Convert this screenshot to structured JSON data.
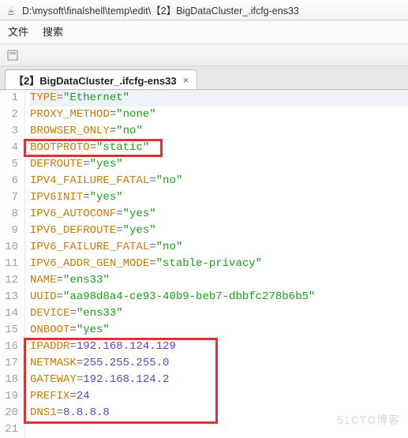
{
  "titlebar": {
    "path": "D:\\mysoft\\finalshell\\temp\\edit\\【2】BigDataCluster_.ifcfg-ens33"
  },
  "menubar": {
    "file": "文件",
    "search": "搜索"
  },
  "tab": {
    "label": "【2】BigDataCluster_.ifcfg-ens33",
    "close": "×"
  },
  "lines": [
    {
      "n": "1",
      "key": "TYPE",
      "eq": "=",
      "val": "\"Ethernet\"",
      "cls": "str"
    },
    {
      "n": "2",
      "key": "PROXY_METHOD",
      "eq": "=",
      "val": "\"none\"",
      "cls": "str"
    },
    {
      "n": "3",
      "key": "BROWSER_ONLY",
      "eq": "=",
      "val": "\"no\"",
      "cls": "str"
    },
    {
      "n": "4",
      "key": "BOOTPROTO",
      "eq": "=",
      "val": "\"static\"",
      "cls": "str"
    },
    {
      "n": "5",
      "key": "DEFROUTE",
      "eq": "=",
      "val": "\"yes\"",
      "cls": "str"
    },
    {
      "n": "6",
      "key": "IPV4_FAILURE_FATAL",
      "eq": "=",
      "val": "\"no\"",
      "cls": "str"
    },
    {
      "n": "7",
      "key": "IPV6INIT",
      "eq": "=",
      "val": "\"yes\"",
      "cls": "str"
    },
    {
      "n": "8",
      "key": "IPV6_AUTOCONF",
      "eq": "=",
      "val": "\"yes\"",
      "cls": "str"
    },
    {
      "n": "9",
      "key": "IPV6_DEFROUTE",
      "eq": "=",
      "val": "\"yes\"",
      "cls": "str"
    },
    {
      "n": "10",
      "key": "IPV6_FAILURE_FATAL",
      "eq": "=",
      "val": "\"no\"",
      "cls": "str"
    },
    {
      "n": "11",
      "key": "IPV6_ADDR_GEN_MODE",
      "eq": "=",
      "val": "\"stable-privacy\"",
      "cls": "str"
    },
    {
      "n": "12",
      "key": "NAME",
      "eq": "=",
      "val": "\"ens33\"",
      "cls": "str"
    },
    {
      "n": "13",
      "key": "UUID",
      "eq": "=",
      "val": "\"aa98d8a4-ce93-40b9-beb7-dbbfc278b6b5\"",
      "cls": "str"
    },
    {
      "n": "14",
      "key": "DEVICE",
      "eq": "=",
      "val": "\"ens33\"",
      "cls": "str"
    },
    {
      "n": "15",
      "key": "ONBOOT",
      "eq": "=",
      "val": "\"yes\"",
      "cls": "str"
    },
    {
      "n": "16",
      "key": "IPADDR",
      "eq": "=",
      "val": "192.168.124.129",
      "cls": "plain"
    },
    {
      "n": "17",
      "key": "NETMASK",
      "eq": "=",
      "val": "255.255.255.0",
      "cls": "plain"
    },
    {
      "n": "18",
      "key": "GATEWAY",
      "eq": "=",
      "val": "192.168.124.2",
      "cls": "plain"
    },
    {
      "n": "19",
      "key": "PREFIX",
      "eq": "=",
      "val": "24",
      "cls": "plain"
    },
    {
      "n": "20",
      "key": "DNS1",
      "eq": "=",
      "val": "8.8.8.8",
      "cls": "plain"
    },
    {
      "n": "21",
      "key": "",
      "eq": "",
      "val": "",
      "cls": ""
    }
  ],
  "watermark": "51CTO博客"
}
